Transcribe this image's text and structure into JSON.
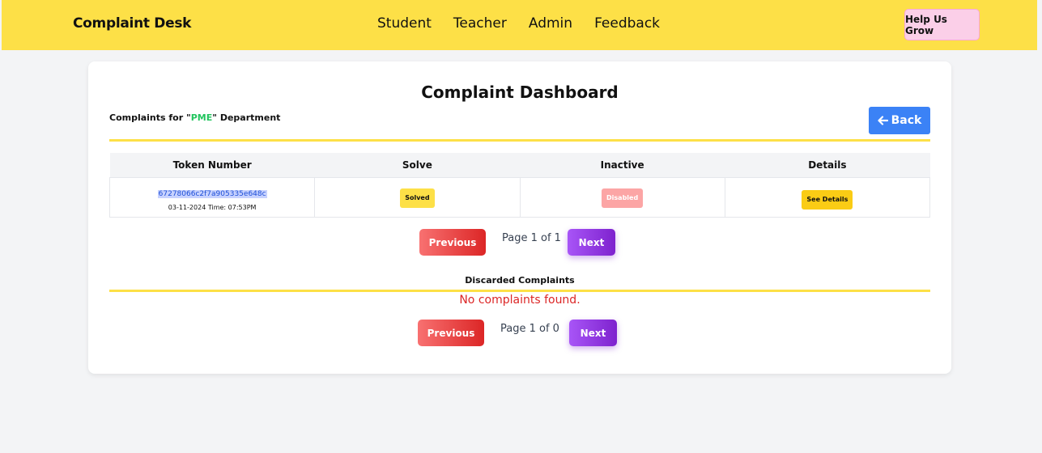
{
  "navbar": {
    "brand": "Complaint Desk",
    "links": [
      "Student",
      "Teacher",
      "Admin",
      "Feedback"
    ],
    "help_button": "Help Us Grow"
  },
  "dashboard": {
    "title": "Complaint Dashboard",
    "dept_prefix": "Complaints for \"",
    "dept_name": "PME",
    "dept_suffix": "\" Department",
    "back_label": "Back",
    "table": {
      "headers": [
        "Token Number",
        "Solve",
        "Inactive",
        "Details"
      ],
      "rows": [
        {
          "token": "67278066c2f7a905335e648c",
          "date": "03-11-2024 Time: 07:53PM",
          "solve": "Solved",
          "inactive": "Disabled",
          "details": "See Details"
        }
      ]
    },
    "pagination": {
      "previous": "Previous",
      "next": "Next",
      "page_info": "Page 1 of 1"
    },
    "discarded": {
      "title": "Discarded Complaints",
      "empty_message": "No complaints found.",
      "pagination": {
        "previous": "Previous",
        "next": "Next",
        "page_info": "Page 1 of 0"
      }
    }
  },
  "colors": {
    "navbar": "#fde047",
    "accent_blue": "#3b82f6",
    "dept_green": "#22c55e",
    "error_red": "#dc2626"
  }
}
